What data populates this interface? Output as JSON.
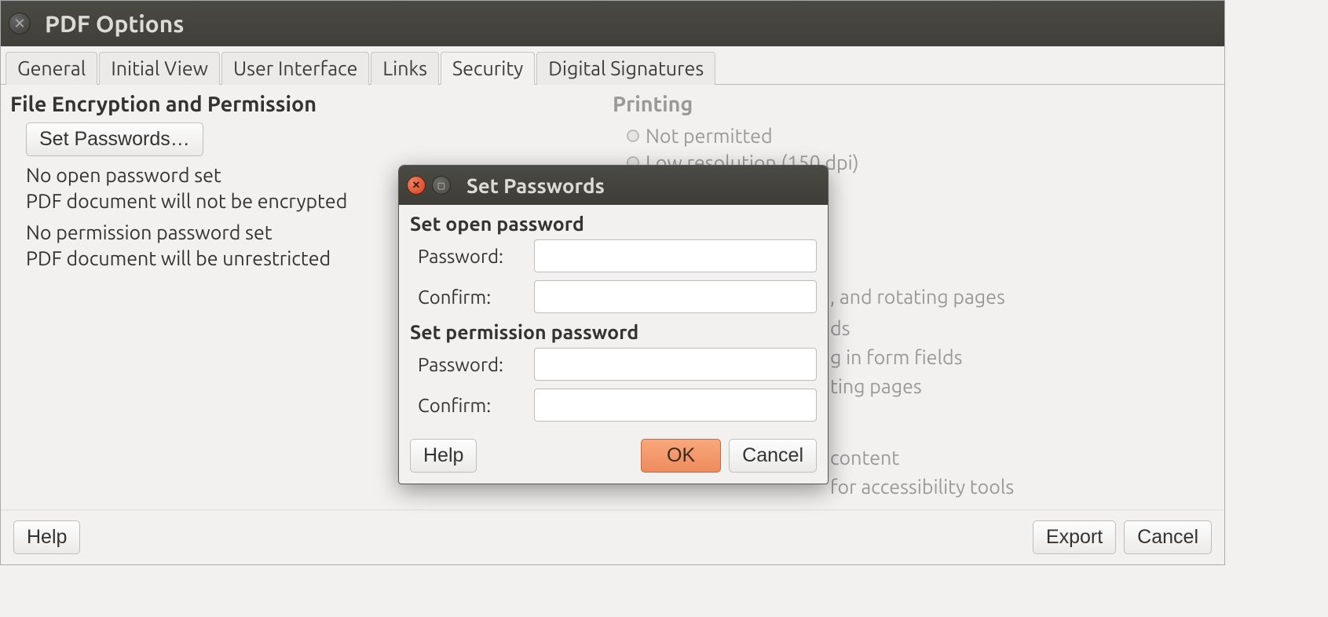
{
  "main": {
    "title": "PDF Options",
    "tabs": [
      {
        "label": "General"
      },
      {
        "label": "Initial View"
      },
      {
        "label": "User Interface"
      },
      {
        "label": "Links"
      },
      {
        "label": "Security",
        "active": true
      },
      {
        "label": "Digital Signatures"
      }
    ],
    "left": {
      "section_title": "File Encryption and Permission",
      "set_passwords_button": "Set Passwords…",
      "status1_line1": "No open password set",
      "status1_line2": "PDF document will not be encrypted",
      "status2_line1": "No permission password set",
      "status2_line2": "PDF document will be unrestricted"
    },
    "right": {
      "printing_title": "Printing",
      "printing_option1": "Not permitted",
      "printing_option2": "Low resolution (150 dpi)",
      "fragment_rotating": ", and rotating pages",
      "fragment_ds": "ds",
      "fragment_form": "g in form fields",
      "fragment_ting": "ting pages",
      "fragment_content": "content",
      "fragment_access": "for accessibility tools"
    },
    "bottom": {
      "help": "Help",
      "export": "Export",
      "cancel": "Cancel"
    }
  },
  "modal": {
    "title": "Set Passwords",
    "open_section": "Set open password",
    "perm_section": "Set permission password",
    "password_label": "Password:",
    "confirm_label": "Confirm:",
    "help": "Help",
    "ok": "OK",
    "cancel": "Cancel"
  }
}
